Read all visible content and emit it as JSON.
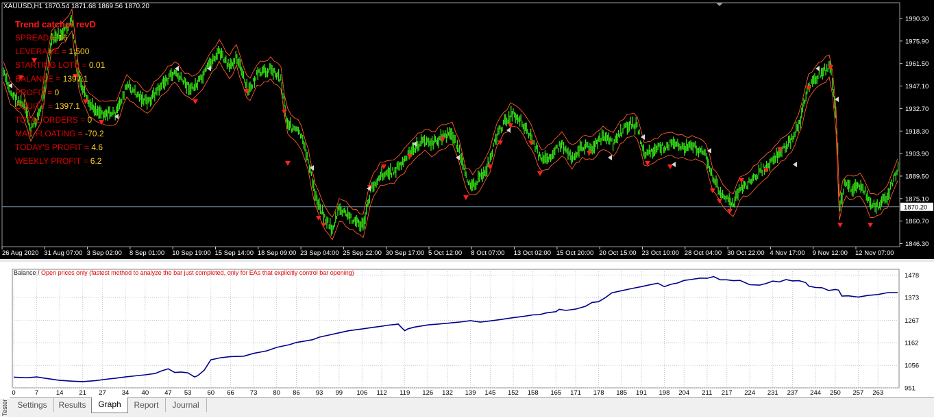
{
  "chart": {
    "symbol_header": "XAUUSD,H1  1870.54 1871.68 1869.56 1870.20",
    "price_ticks": [
      "1990.30",
      "1975.90",
      "1961.50",
      "1947.10",
      "1932.70",
      "1918.30",
      "1903.90",
      "1889.50",
      "1875.10",
      "1860.70",
      "1846.30"
    ],
    "current_price": "1870.20",
    "date_ticks": [
      "26 Aug 2020",
      "31 Aug 07:00",
      "3 Sep 02:00",
      "8 Sep 01:00",
      "10 Sep 19:00",
      "15 Sep 14:00",
      "18 Sep 09:00",
      "23 Sep 04:00",
      "25 Sep 22:00",
      "30 Sep 17:00",
      "5 Oct 12:00",
      "8 Oct 07:00",
      "13 Oct 02:00",
      "15 Oct 20:00",
      "20 Oct 15:00",
      "23 Oct 10:00",
      "28 Oct 04:00",
      "30 Oct 22:00",
      "4 Nov 17:00",
      "9 Nov 12:00",
      "12 Nov 07:00"
    ],
    "colors": {
      "background": "#000000",
      "candles": "#35e016",
      "envelope": "#ff5a2a",
      "buy_marker": "#ff2020",
      "close_marker": "#d8d8d8"
    }
  },
  "ea": {
    "title": "Trend catcher revD",
    "rows": [
      {
        "key": "SPREAD = ",
        "value": "16"
      },
      {
        "key": "LEVERAGE = ",
        "value": "1:500"
      },
      {
        "key": "STARTING LOTS = ",
        "value": "0.01"
      },
      {
        "key": "BALANCE = ",
        "value": "1397.1"
      },
      {
        "key": "PROFIT = ",
        "value": "0"
      },
      {
        "key": "EQUITY = ",
        "value": "1397.1"
      },
      {
        "key": "TOTAL ORDERS = ",
        "value": "0"
      },
      {
        "key": "MAX FLOATING = ",
        "value": "-70.2"
      },
      {
        "key": "TODAY'S PROFIT = ",
        "value": "4.6"
      },
      {
        "key": "WEEKLY PROFIT = ",
        "value": "6.2"
      }
    ]
  },
  "graph": {
    "legend_series": "Balance",
    "legend_sep": " / ",
    "legend_mode": "Open prices only (fastest method to analyze the bar just completed, only for EAs that explicitly control bar opening)",
    "y_ticks": [
      "1478",
      "1373",
      "1267",
      "1162",
      "1056",
      "951"
    ],
    "x_ticks": [
      "0",
      "7",
      "14",
      "21",
      "27",
      "34",
      "40",
      "47",
      "53",
      "60",
      "66",
      "73",
      "80",
      "86",
      "93",
      "99",
      "106",
      "112",
      "119",
      "126",
      "132",
      "139",
      "145",
      "152",
      "158",
      "165",
      "171",
      "178",
      "185",
      "191",
      "198",
      "204",
      "211",
      "217",
      "224",
      "231",
      "237",
      "244",
      "250",
      "257",
      "263"
    ],
    "colors": {
      "line": "#00008b",
      "grid": "#c8c8c8"
    }
  },
  "chart_data": {
    "type": "line",
    "title": "",
    "xlabel": "",
    "ylabel": "",
    "xlim": [
      0,
      269
    ],
    "ylim": [
      951,
      1505
    ],
    "grid": true,
    "series": [
      {
        "name": "Balance",
        "x": [
          0,
          4,
          7,
          10,
          14,
          18,
          21,
          25,
          28,
          31,
          34,
          37,
          40,
          43,
          45,
          47,
          49,
          51,
          53,
          55,
          56,
          58,
          60,
          63,
          66,
          70,
          73,
          77,
          80,
          84,
          86,
          88,
          91,
          93,
          96,
          99,
          102,
          106,
          109,
          112,
          114,
          116,
          117,
          118,
          119,
          120,
          122,
          126,
          132,
          136,
          139,
          142,
          145,
          148,
          152,
          156,
          158,
          160,
          162,
          165,
          166,
          168,
          171,
          174,
          176,
          178,
          180,
          182,
          185,
          188,
          191,
          194,
          196,
          198,
          200,
          202,
          204,
          206,
          209,
          211,
          213,
          215,
          217,
          219,
          221,
          224,
          227,
          229,
          231,
          233,
          235,
          237,
          239,
          241,
          242,
          244,
          246,
          248,
          250,
          251,
          252,
          254,
          257,
          260,
          263,
          266,
          269
        ],
        "values": [
          1001,
          998,
          1002,
          995,
          986,
          982,
          980,
          985,
          991,
          996,
          1002,
          1007,
          1012,
          1018,
          1030,
          1040,
          1023,
          1025,
          1021,
          1002,
          1008,
          1034,
          1082,
          1092,
          1097,
          1099,
          1112,
          1124,
          1140,
          1153,
          1163,
          1168,
          1176,
          1188,
          1198,
          1208,
          1218,
          1226,
          1233,
          1239,
          1244,
          1247,
          1249,
          1233,
          1218,
          1227,
          1235,
          1245,
          1253,
          1259,
          1265,
          1258,
          1264,
          1270,
          1279,
          1287,
          1292,
          1293,
          1301,
          1307,
          1318,
          1313,
          1319,
          1332,
          1350,
          1354,
          1372,
          1395,
          1405,
          1415,
          1424,
          1434,
          1440,
          1424,
          1435,
          1441,
          1453,
          1457,
          1464,
          1463,
          1471,
          1456,
          1456,
          1452,
          1453,
          1433,
          1431,
          1439,
          1450,
          1446,
          1457,
          1451,
          1452,
          1443,
          1426,
          1420,
          1419,
          1406,
          1411,
          1408,
          1380,
          1381,
          1375,
          1383,
          1387,
          1396,
          1396
        ]
      }
    ]
  }
}
